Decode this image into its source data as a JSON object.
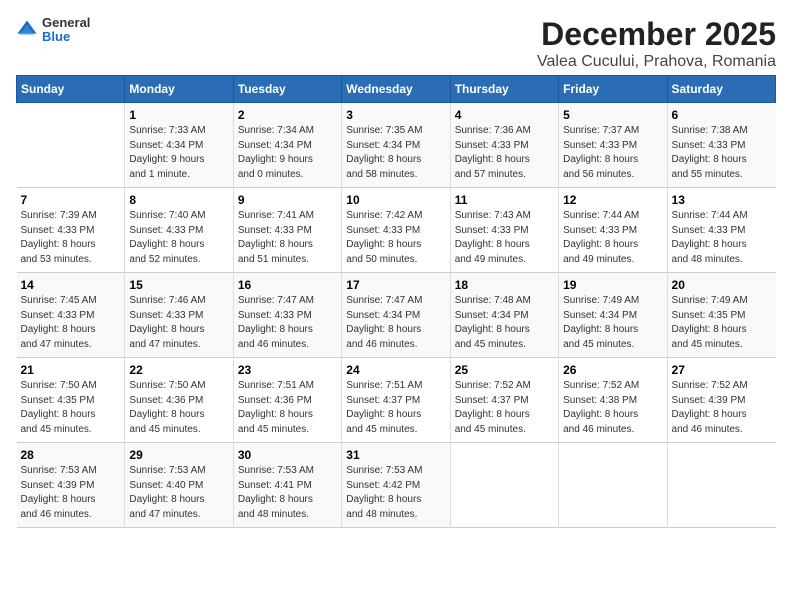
{
  "logo": {
    "general": "General",
    "blue": "Blue"
  },
  "title": "December 2025",
  "subtitle": "Valea Cucului, Prahova, Romania",
  "columns": [
    "Sunday",
    "Monday",
    "Tuesday",
    "Wednesday",
    "Thursday",
    "Friday",
    "Saturday"
  ],
  "weeks": [
    [
      {
        "day": "",
        "info": ""
      },
      {
        "day": "1",
        "info": "Sunrise: 7:33 AM\nSunset: 4:34 PM\nDaylight: 9 hours\nand 1 minute."
      },
      {
        "day": "2",
        "info": "Sunrise: 7:34 AM\nSunset: 4:34 PM\nDaylight: 9 hours\nand 0 minutes."
      },
      {
        "day": "3",
        "info": "Sunrise: 7:35 AM\nSunset: 4:34 PM\nDaylight: 8 hours\nand 58 minutes."
      },
      {
        "day": "4",
        "info": "Sunrise: 7:36 AM\nSunset: 4:33 PM\nDaylight: 8 hours\nand 57 minutes."
      },
      {
        "day": "5",
        "info": "Sunrise: 7:37 AM\nSunset: 4:33 PM\nDaylight: 8 hours\nand 56 minutes."
      },
      {
        "day": "6",
        "info": "Sunrise: 7:38 AM\nSunset: 4:33 PM\nDaylight: 8 hours\nand 55 minutes."
      }
    ],
    [
      {
        "day": "7",
        "info": "Sunrise: 7:39 AM\nSunset: 4:33 PM\nDaylight: 8 hours\nand 53 minutes."
      },
      {
        "day": "8",
        "info": "Sunrise: 7:40 AM\nSunset: 4:33 PM\nDaylight: 8 hours\nand 52 minutes."
      },
      {
        "day": "9",
        "info": "Sunrise: 7:41 AM\nSunset: 4:33 PM\nDaylight: 8 hours\nand 51 minutes."
      },
      {
        "day": "10",
        "info": "Sunrise: 7:42 AM\nSunset: 4:33 PM\nDaylight: 8 hours\nand 50 minutes."
      },
      {
        "day": "11",
        "info": "Sunrise: 7:43 AM\nSunset: 4:33 PM\nDaylight: 8 hours\nand 49 minutes."
      },
      {
        "day": "12",
        "info": "Sunrise: 7:44 AM\nSunset: 4:33 PM\nDaylight: 8 hours\nand 49 minutes."
      },
      {
        "day": "13",
        "info": "Sunrise: 7:44 AM\nSunset: 4:33 PM\nDaylight: 8 hours\nand 48 minutes."
      }
    ],
    [
      {
        "day": "14",
        "info": "Sunrise: 7:45 AM\nSunset: 4:33 PM\nDaylight: 8 hours\nand 47 minutes."
      },
      {
        "day": "15",
        "info": "Sunrise: 7:46 AM\nSunset: 4:33 PM\nDaylight: 8 hours\nand 47 minutes."
      },
      {
        "day": "16",
        "info": "Sunrise: 7:47 AM\nSunset: 4:33 PM\nDaylight: 8 hours\nand 46 minutes."
      },
      {
        "day": "17",
        "info": "Sunrise: 7:47 AM\nSunset: 4:34 PM\nDaylight: 8 hours\nand 46 minutes."
      },
      {
        "day": "18",
        "info": "Sunrise: 7:48 AM\nSunset: 4:34 PM\nDaylight: 8 hours\nand 45 minutes."
      },
      {
        "day": "19",
        "info": "Sunrise: 7:49 AM\nSunset: 4:34 PM\nDaylight: 8 hours\nand 45 minutes."
      },
      {
        "day": "20",
        "info": "Sunrise: 7:49 AM\nSunset: 4:35 PM\nDaylight: 8 hours\nand 45 minutes."
      }
    ],
    [
      {
        "day": "21",
        "info": "Sunrise: 7:50 AM\nSunset: 4:35 PM\nDaylight: 8 hours\nand 45 minutes."
      },
      {
        "day": "22",
        "info": "Sunrise: 7:50 AM\nSunset: 4:36 PM\nDaylight: 8 hours\nand 45 minutes."
      },
      {
        "day": "23",
        "info": "Sunrise: 7:51 AM\nSunset: 4:36 PM\nDaylight: 8 hours\nand 45 minutes."
      },
      {
        "day": "24",
        "info": "Sunrise: 7:51 AM\nSunset: 4:37 PM\nDaylight: 8 hours\nand 45 minutes."
      },
      {
        "day": "25",
        "info": "Sunrise: 7:52 AM\nSunset: 4:37 PM\nDaylight: 8 hours\nand 45 minutes."
      },
      {
        "day": "26",
        "info": "Sunrise: 7:52 AM\nSunset: 4:38 PM\nDaylight: 8 hours\nand 46 minutes."
      },
      {
        "day": "27",
        "info": "Sunrise: 7:52 AM\nSunset: 4:39 PM\nDaylight: 8 hours\nand 46 minutes."
      }
    ],
    [
      {
        "day": "28",
        "info": "Sunrise: 7:53 AM\nSunset: 4:39 PM\nDaylight: 8 hours\nand 46 minutes."
      },
      {
        "day": "29",
        "info": "Sunrise: 7:53 AM\nSunset: 4:40 PM\nDaylight: 8 hours\nand 47 minutes."
      },
      {
        "day": "30",
        "info": "Sunrise: 7:53 AM\nSunset: 4:41 PM\nDaylight: 8 hours\nand 48 minutes."
      },
      {
        "day": "31",
        "info": "Sunrise: 7:53 AM\nSunset: 4:42 PM\nDaylight: 8 hours\nand 48 minutes."
      },
      {
        "day": "",
        "info": ""
      },
      {
        "day": "",
        "info": ""
      },
      {
        "day": "",
        "info": ""
      }
    ]
  ]
}
